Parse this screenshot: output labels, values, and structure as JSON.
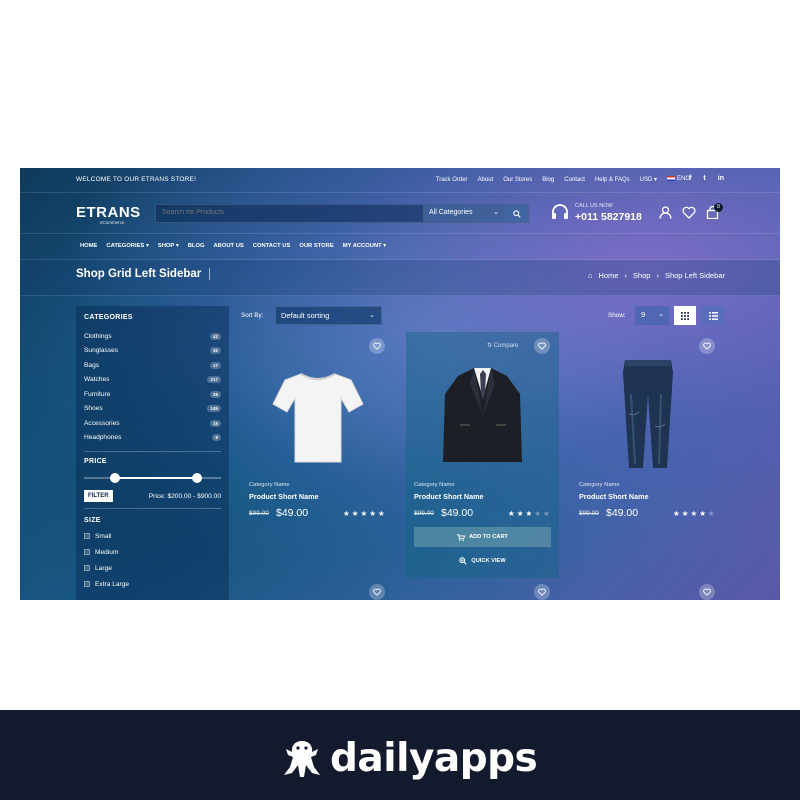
{
  "topbar": {
    "welcome": "WELCOME TO OUR ETRANS STORE!",
    "links": [
      "Track Order",
      "About",
      "Our Stores",
      "Blog",
      "Contact",
      "Help & FAQs"
    ],
    "currency": "USD",
    "language": "ENG",
    "social": [
      "f",
      "t",
      "in"
    ]
  },
  "header": {
    "logo": "ETRANS",
    "logo_sub": "eCommerce",
    "search_placeholder": "Search for Products",
    "search_category": "All Categories",
    "call_label": "CALL US NOW",
    "call_number": "+011 5827918",
    "cart_count": "8"
  },
  "nav": {
    "items": [
      "HOME",
      "CATEGORIES",
      "SHOP",
      "BLOG",
      "ABOUT US",
      "CONTACT US",
      "OUR STORE",
      "MY ACCOUNT"
    ]
  },
  "titlebar": {
    "title": "Shop Grid Left Sidebar",
    "breadcrumb": [
      "Home",
      "Shop",
      "Shop Left Sidebar"
    ]
  },
  "sidebar": {
    "categories_title": "CATEGORIES",
    "categories": [
      {
        "name": "Clothings",
        "count": "42"
      },
      {
        "name": "Sunglasses",
        "count": "32"
      },
      {
        "name": "Bags",
        "count": "17"
      },
      {
        "name": "Watches",
        "count": "217"
      },
      {
        "name": "Furniture",
        "count": "28"
      },
      {
        "name": "Shoes",
        "count": "145"
      },
      {
        "name": "Accessories",
        "count": "15"
      },
      {
        "name": "Headphones",
        "count": "8"
      }
    ],
    "price_title": "PRICE",
    "filter_label": "FILTER",
    "price_range": "Price: $200.00 - $900.00",
    "size_title": "SIZE",
    "sizes": [
      "Small",
      "Medium",
      "Large",
      "Extra Large"
    ]
  },
  "toolbar": {
    "sort_label": "Sort By:",
    "sort_value": "Default sorting",
    "show_label": "Show:",
    "show_value": "9"
  },
  "products": [
    {
      "category": "Category Name",
      "name": "Product Short Name",
      "old_price": "$99.00",
      "price": "$49.00",
      "rating": 5
    },
    {
      "category": "Category Name",
      "name": "Product Short Name",
      "old_price": "$99.00",
      "price": "$49.00",
      "rating": 3,
      "compare": "Compare",
      "add_to_cart": "ADD TO CART",
      "quick_view": "QUICK VIEW"
    },
    {
      "category": "Category Name",
      "name": "Product Short Name",
      "old_price": "$99.00",
      "price": "$49.00",
      "rating": 4
    }
  ],
  "footer": {
    "brand": "dailyapps"
  },
  "colors": {
    "footer_bg": "#141a2e",
    "accent_white": "#ffffff"
  }
}
